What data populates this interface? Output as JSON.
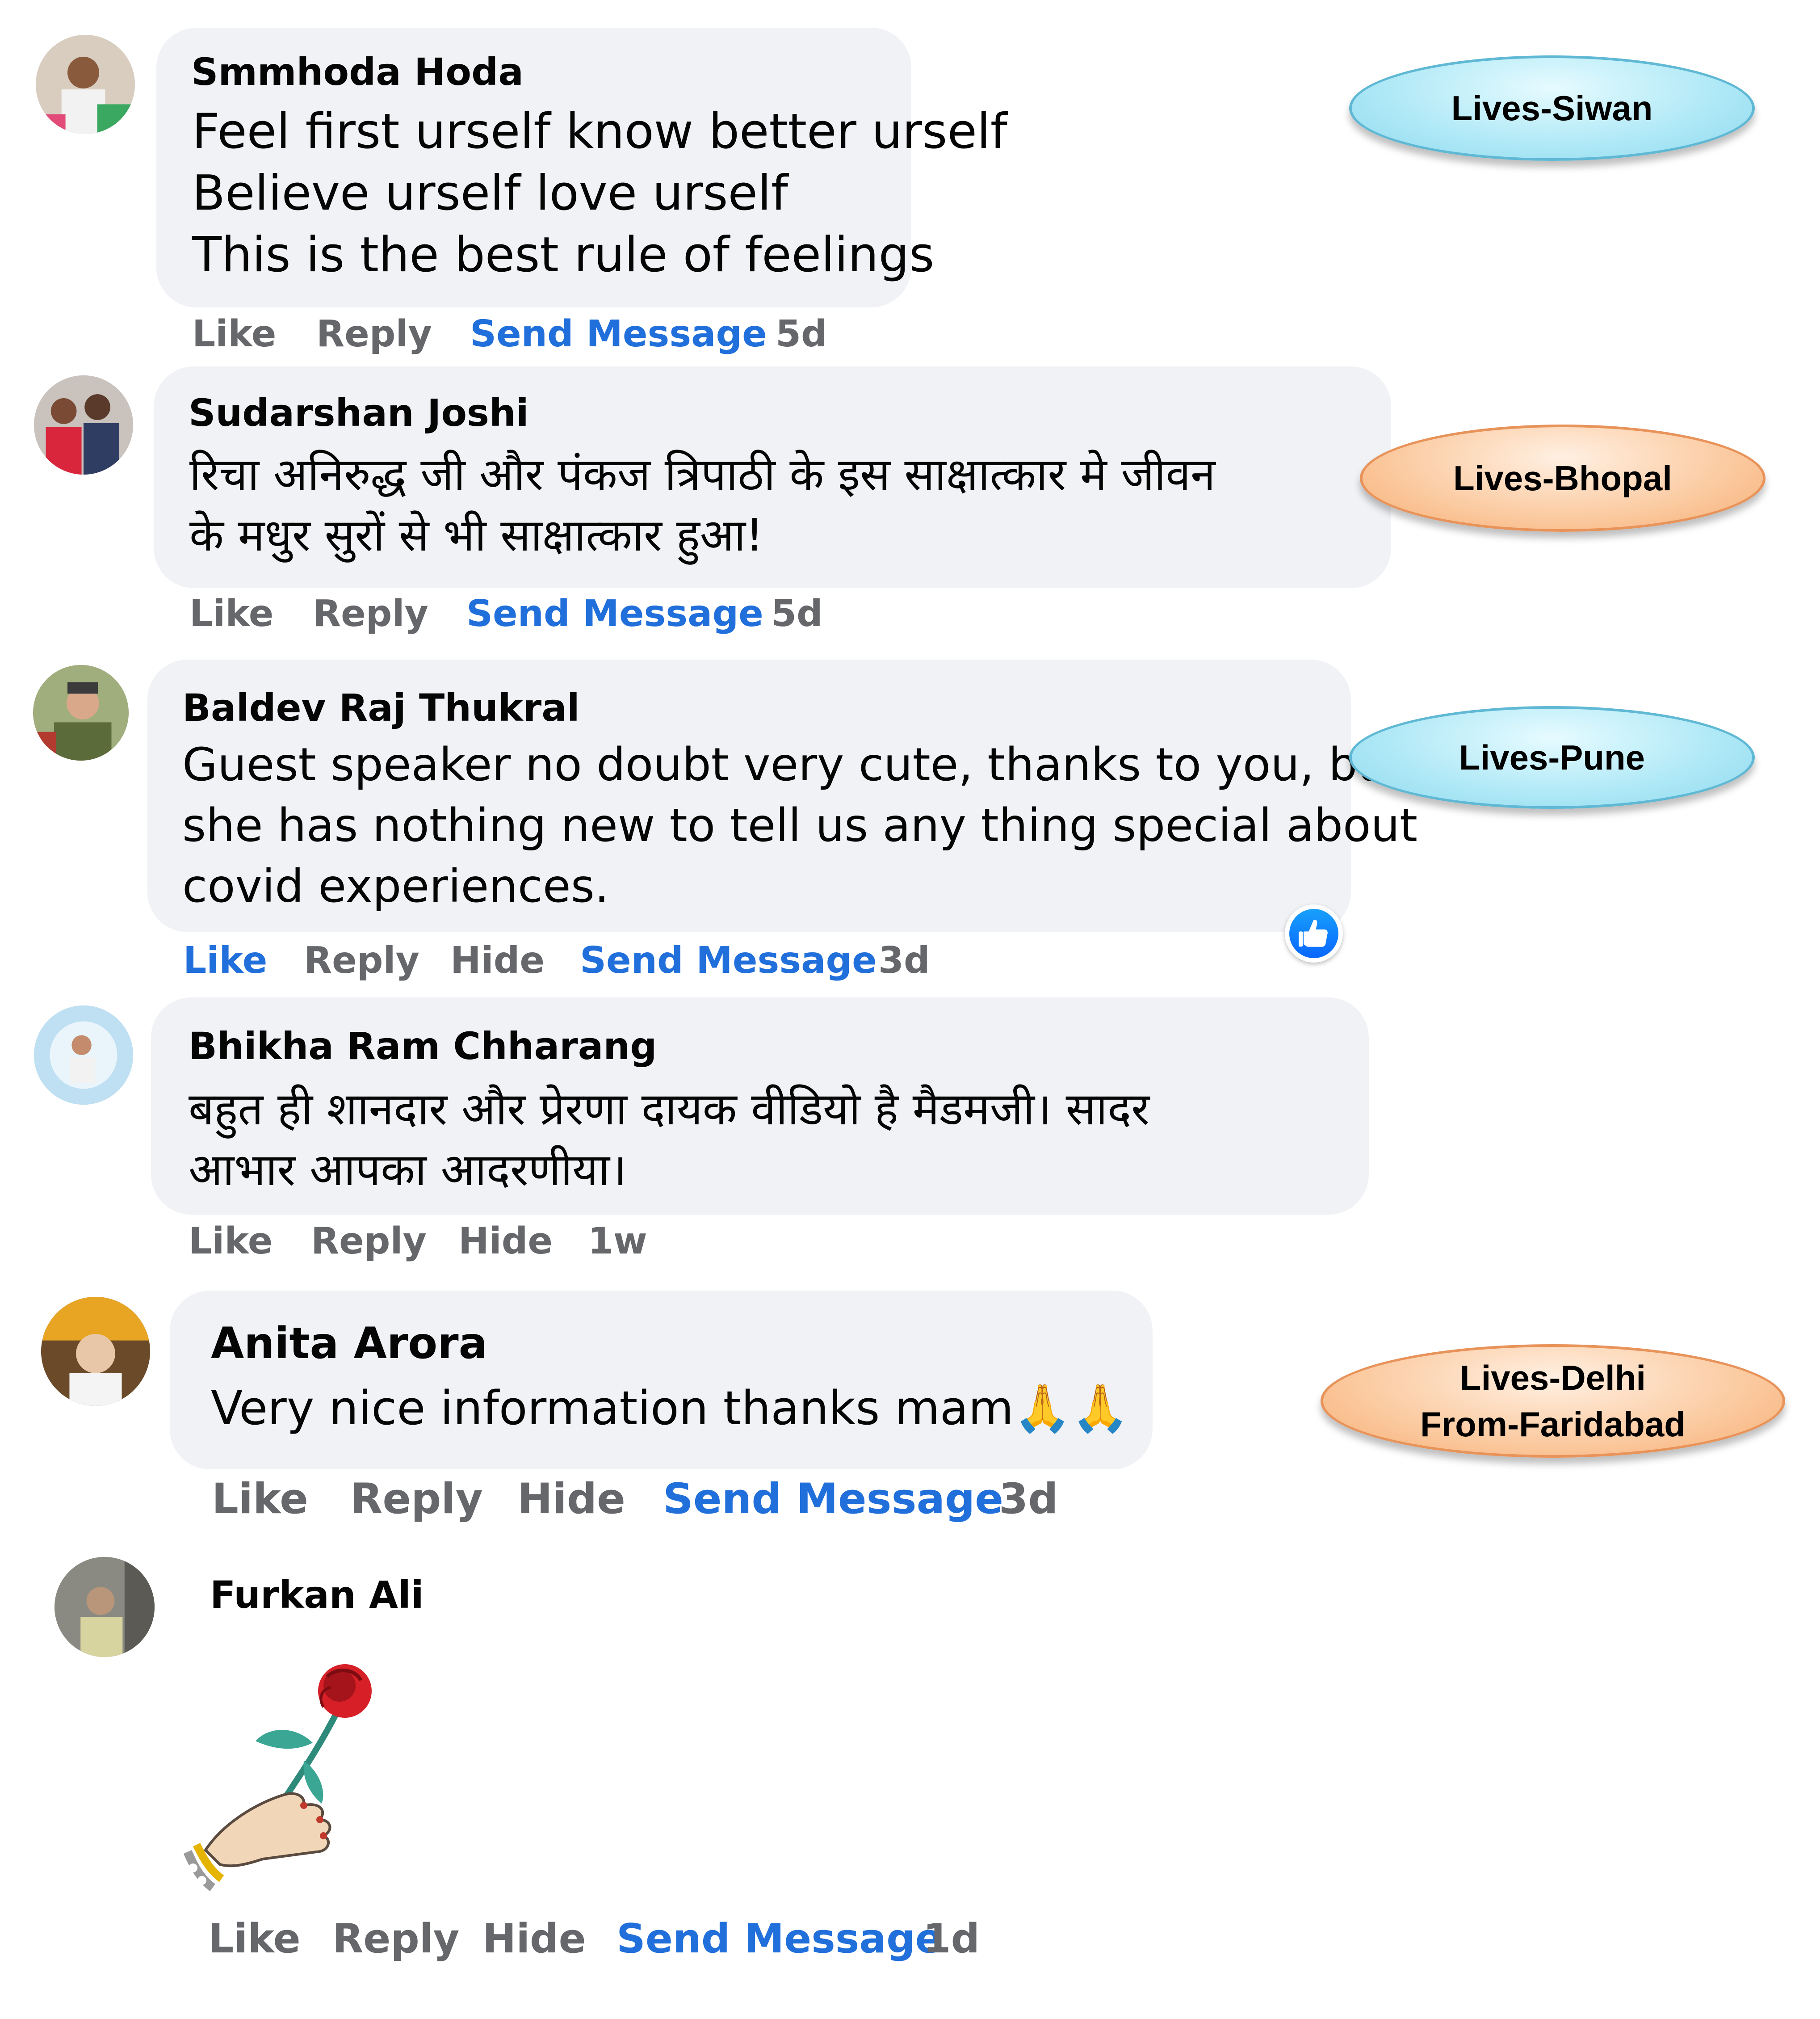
{
  "comments": [
    {
      "author": "Smmhoda Hoda",
      "lines": [
        "Feel first urself know better urself",
        "Believe urself love urself",
        "This is the best rule of feelings"
      ],
      "actions": [
        "Like",
        "Reply",
        "Send Message"
      ],
      "time": "5d",
      "tag": "Lives-Siwan"
    },
    {
      "author": "Sudarshan Joshi",
      "lines": [
        "रिचा अनिरुद्ध जी और पंकज त्रिपाठी के इस साक्षात्कार मे जीवन",
        "के मधुर सुरों से भी साक्षात्कार हुआ!"
      ],
      "actions": [
        "Like",
        "Reply",
        "Send Message"
      ],
      "time": "5d",
      "tag": "Lives-Bhopal"
    },
    {
      "author": "Baldev Raj Thukral",
      "lines": [
        "Guest speaker no doubt very cute, thanks to you, but",
        "she has nothing new to tell us any thing special about",
        "covid experiences."
      ],
      "actions": [
        "Like",
        "Reply",
        "Hide",
        "Send Message"
      ],
      "time": "3d",
      "tag": "Lives-Pune"
    },
    {
      "author": "Bhikha Ram Chharang",
      "lines": [
        "बहुत ही शानदार और प्रेरणा दायक वीडियो है मैडमजी। सादर",
        "आभार आपका आदरणीया।"
      ],
      "actions": [
        "Like",
        "Reply",
        "Hide"
      ],
      "time": "1w"
    },
    {
      "author": "Anita Arora",
      "lines": [
        "Very nice information thanks mam🙏🙏"
      ],
      "actions": [
        "Like",
        "Reply",
        "Hide",
        "Send Message"
      ],
      "time": "3d",
      "tag_lines": [
        "Lives-Delhi",
        "From-Faridabad"
      ]
    },
    {
      "author": "Furkan Ali",
      "sticker": "rose-in-hand-sticker",
      "actions": [
        "Like",
        "Reply",
        "Hide",
        "Send Message"
      ],
      "time": "1d"
    }
  ],
  "colors": {
    "bubble": "#f0f2f5",
    "link": "#216fdb",
    "muted": "#65676b",
    "tag_blue": "#aee8f6",
    "tag_orange": "#fbcaa0"
  }
}
